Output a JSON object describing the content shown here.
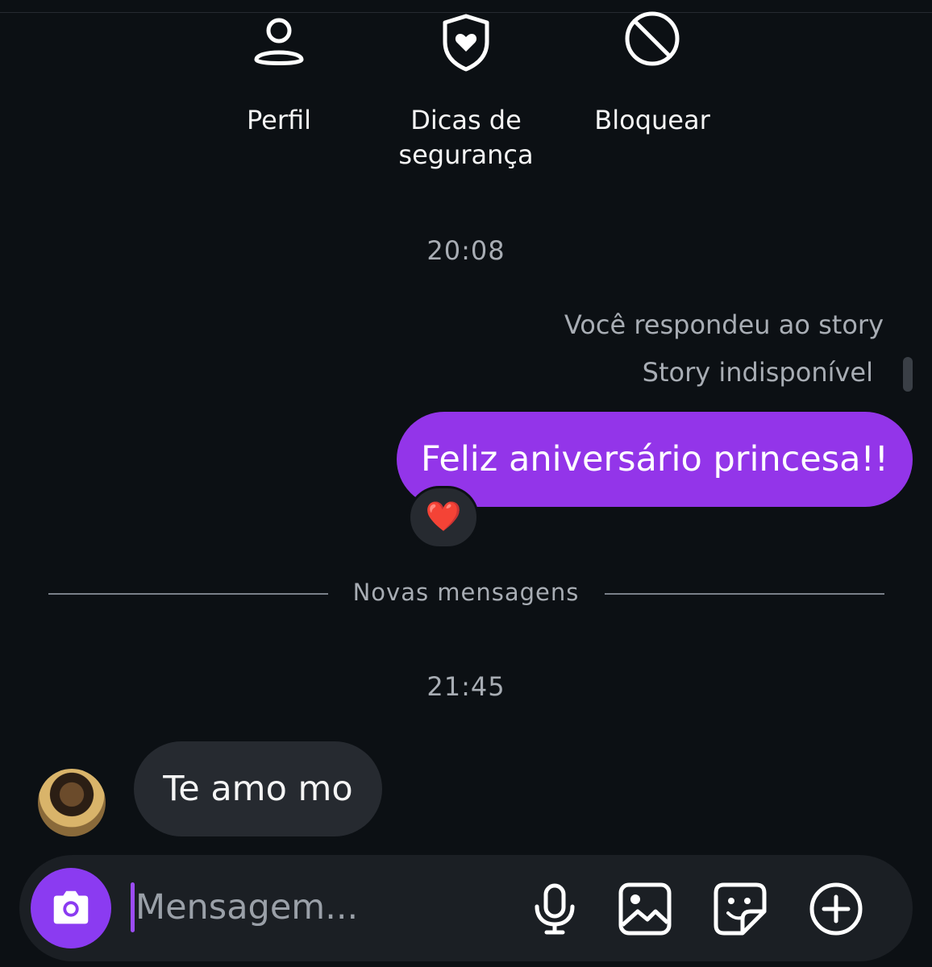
{
  "actions": {
    "profile": {
      "label": "Perfil",
      "icon": "person-icon"
    },
    "safety": {
      "label": "Dicas de segurança",
      "icon": "shield-heart-icon"
    },
    "block": {
      "label": "Bloquear",
      "icon": "block-icon"
    }
  },
  "thread": {
    "timestamp_1": "20:08",
    "story_reply_note": "Você respondeu ao story",
    "story_unavailable": "Story indisponível",
    "outgoing_message": "Feliz aniversário princesa!!",
    "reaction": "❤️",
    "new_messages_label": "Novas mensagens",
    "timestamp_2": "21:45",
    "incoming_message": "Te amo mo"
  },
  "composer": {
    "placeholder": "Mensagem...",
    "icons": [
      "camera-icon",
      "microphone-icon",
      "gallery-icon",
      "sticker-icon",
      "plus-icon"
    ]
  },
  "colors": {
    "background": "#0c1014",
    "outgoing_bubble": "#9335e9",
    "incoming_bubble": "#262a30",
    "camera_button": "#8b3bf1",
    "muted_text": "#a8adb4"
  }
}
